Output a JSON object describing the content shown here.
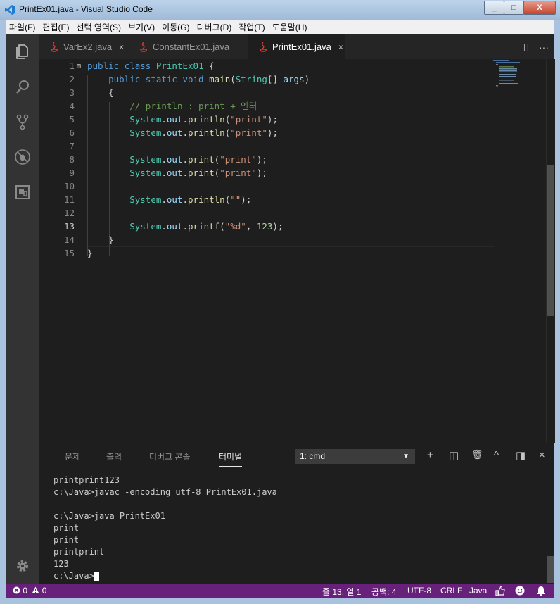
{
  "window": {
    "title": "PrintEx01.java - Visual Studio Code",
    "buttons": [
      "_",
      "□",
      "X"
    ]
  },
  "menu": [
    "파일(F)",
    "편집(E)",
    "선택 영역(S)",
    "보기(V)",
    "이동(G)",
    "디버그(D)",
    "작업(T)",
    "도움말(H)"
  ],
  "tabs": [
    {
      "label": "VarEx2.java",
      "close": "×"
    },
    {
      "label": "ConstantEx01.java"
    },
    {
      "label": "PrintEx01.java",
      "close": "×"
    }
  ],
  "tab_actions": {
    "split": "◫",
    "more": "···"
  },
  "editor": {
    "line_numbers": [
      "1",
      "2",
      "3",
      "4",
      "5",
      "6",
      "7",
      "8",
      "9",
      "10",
      "11",
      "12",
      "13",
      "14",
      "15"
    ],
    "current_line": "13",
    "fold_marker": "⊟"
  },
  "panel": {
    "tabs": [
      "문제",
      "출력",
      "디버그 콘솔",
      "터미널"
    ],
    "terminal_select": "1: cmd",
    "caret": "▼",
    "actions": {
      "add": "+",
      "split": "◫",
      "trash": "🗑",
      "maximize": "^",
      "layout": "◨",
      "close": "×"
    },
    "terminal_lines": [
      "printprint123",
      "c:\\Java>javac -encoding utf-8 PrintEx01.java",
      "",
      "c:\\Java>java PrintEx01",
      "print",
      "print",
      "printprint",
      "123",
      "c:\\Java>"
    ]
  },
  "status": {
    "errors": "0",
    "warnings": "0",
    "position": "줄 13, 열 1",
    "spaces": "공백: 4",
    "encoding": "UTF-8",
    "eol": "CRLF",
    "language": "Java"
  },
  "colors": {
    "status_bar": "#68217a",
    "keyword": "#569cd6",
    "class": "#4ec9b0",
    "string": "#ce9178",
    "comment": "#6a9955"
  }
}
